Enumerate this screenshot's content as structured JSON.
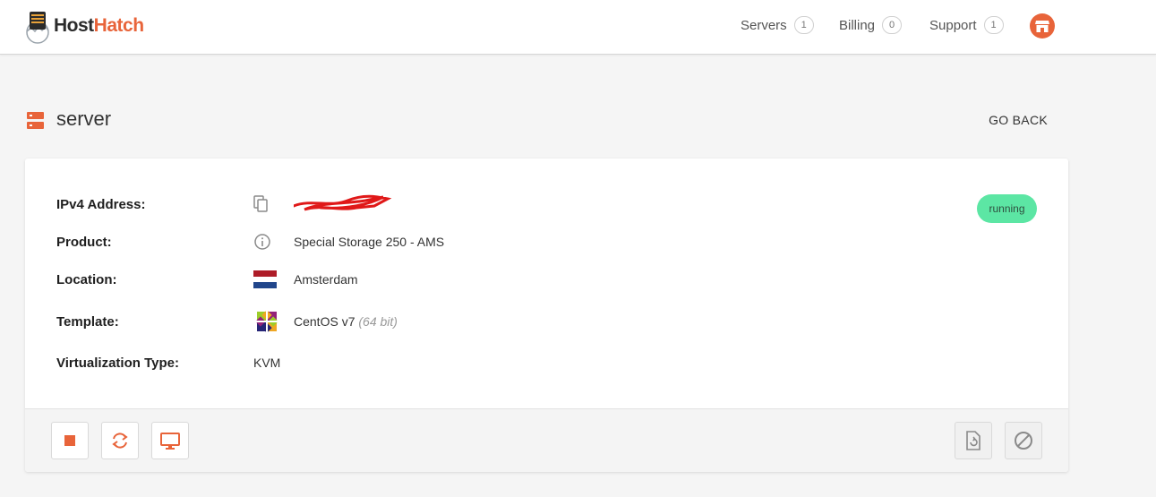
{
  "brand": {
    "name_part1": "Host",
    "name_part2": "Hatch",
    "accent_color": "#e8643a"
  },
  "nav": {
    "items": [
      {
        "label": "Servers",
        "count": "1"
      },
      {
        "label": "Billing",
        "count": "0"
      },
      {
        "label": "Support",
        "count": "1"
      }
    ],
    "avatar_icon": "store-icon"
  },
  "page": {
    "title": "server",
    "icon": "server-icon",
    "go_back_label": "GO BACK"
  },
  "server": {
    "status": "running",
    "status_color": "#5ce6a4",
    "details": [
      {
        "label": "IPv4 Address:",
        "icon": "copy-icon",
        "value": ""
      },
      {
        "label": "Product:",
        "icon": "info-icon",
        "value": "Special Storage 250 - AMS"
      },
      {
        "label": "Location:",
        "icon": "netherlands-flag-icon",
        "value": "Amsterdam"
      },
      {
        "label": "Template:",
        "icon": "centos-logo-icon",
        "value": "CentOS v7",
        "value_extra": "(64 bit)"
      },
      {
        "label": "Virtualization Type:",
        "icon": "",
        "value": "KVM"
      }
    ]
  },
  "actions": {
    "left": [
      "stop-icon",
      "restart-icon",
      "console-icon"
    ],
    "right": [
      "reinstall-icon",
      "cancel-icon"
    ]
  }
}
